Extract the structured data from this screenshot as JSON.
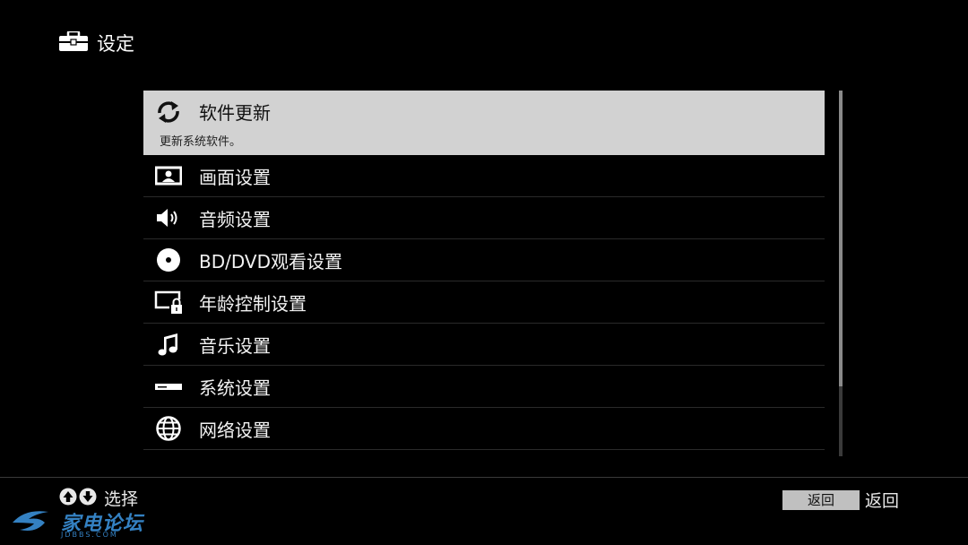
{
  "header": {
    "title": "设定",
    "icon": "toolbox-icon"
  },
  "menu": {
    "items": [
      {
        "label": "软件更新",
        "description": "更新系统软件。",
        "icon": "refresh-icon",
        "selected": true
      },
      {
        "label": "画面设置",
        "icon": "picture-icon"
      },
      {
        "label": "音频设置",
        "icon": "speaker-icon"
      },
      {
        "label": "BD/DVD观看设置",
        "icon": "disc-icon"
      },
      {
        "label": "年龄控制设置",
        "icon": "parental-lock-icon"
      },
      {
        "label": "音乐设置",
        "icon": "music-note-icon"
      },
      {
        "label": "系统设置",
        "icon": "device-icon"
      },
      {
        "label": "网络设置",
        "icon": "globe-icon"
      }
    ]
  },
  "footer": {
    "select_hint": "选择",
    "back_key": "返回",
    "back_hint": "返回"
  },
  "watermark": {
    "text": "家电论坛",
    "domain": "JDBBS.COM"
  },
  "colors": {
    "background": "#000000",
    "selected_row": "#d2d2d2",
    "watermark": "#3a8fd8"
  }
}
